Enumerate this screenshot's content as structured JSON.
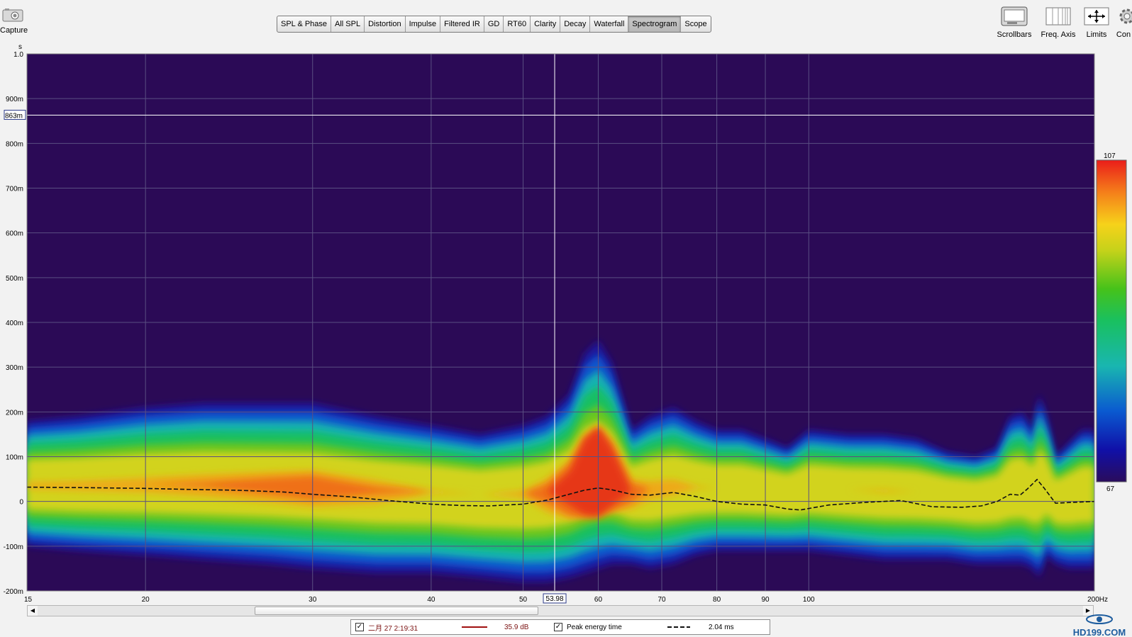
{
  "toolbar": {
    "capture_label": "Capture",
    "scrollbars_label": "Scrollbars",
    "freq_axis_label": "Freq. Axis",
    "limits_label": "Limits",
    "controls_label_partial": "Con"
  },
  "tabs": [
    "SPL & Phase",
    "All SPL",
    "Distortion",
    "Impulse",
    "Filtered IR",
    "GD",
    "RT60",
    "Clarity",
    "Decay",
    "Waterfall",
    "Spectrogram",
    "Scope"
  ],
  "active_tab": "Spectrogram",
  "chart_data": {
    "type": "heatmap",
    "title": "",
    "xlabel": "Hz",
    "ylabel": "s",
    "x_scale": "log",
    "xlim": [
      15,
      200
    ],
    "ylim": [
      -0.2,
      1.0
    ],
    "x_ticks": [
      15,
      20,
      30,
      40,
      50,
      60,
      70,
      80,
      90,
      100,
      200
    ],
    "x_tick_labels": [
      "15",
      "20",
      "30",
      "40",
      "50",
      "60",
      "70",
      "80",
      "90",
      "100",
      "200Hz"
    ],
    "y_ticks": [
      1.0,
      0.9,
      0.8,
      0.7,
      0.6,
      0.5,
      0.4,
      0.3,
      0.2,
      0.1,
      0.0,
      -0.1,
      -0.2
    ],
    "y_tick_labels": [
      "1.0",
      "900m",
      "800m",
      "700m",
      "600m",
      "500m",
      "400m",
      "300m",
      "200m",
      "100m",
      "0",
      "-100m",
      "-200m"
    ],
    "grid": true,
    "cursor": {
      "x": 53.98,
      "x_label": "53.98",
      "y": 0.863,
      "y_label": "863m"
    },
    "color_scale": {
      "max": 107,
      "min": 67,
      "max_label": "107",
      "min_label": "67",
      "colors": [
        "#2a0c5c",
        "#1010a8",
        "#0a5ad0",
        "#19b6b0",
        "#19c060",
        "#46c21a",
        "#c6d21a",
        "#f6d21a",
        "#f57f1a",
        "#ea1d1a"
      ]
    },
    "series": [
      {
        "name": "Peak energy time",
        "style": "dashed",
        "x": [
          15,
          17,
          20,
          22,
          25,
          28,
          30,
          33,
          36,
          40,
          43,
          46,
          50,
          53,
          55,
          58,
          60,
          62,
          65,
          68,
          72,
          76,
          80,
          85,
          90,
          95,
          98,
          105,
          115,
          125,
          135,
          145,
          152,
          158,
          163,
          167,
          170,
          174,
          177,
          182,
          190,
          200
        ],
        "y": [
          0.032,
          0.031,
          0.029,
          0.027,
          0.025,
          0.021,
          0.016,
          0.01,
          0.002,
          -0.006,
          -0.009,
          -0.01,
          -0.006,
          0.003,
          0.012,
          0.025,
          0.03,
          0.026,
          0.016,
          0.014,
          0.02,
          0.011,
          0.0,
          -0.006,
          -0.008,
          -0.017,
          -0.019,
          -0.008,
          -0.002,
          0.002,
          -0.012,
          -0.013,
          -0.01,
          0.0,
          0.016,
          0.014,
          0.028,
          0.049,
          0.03,
          -0.004,
          -0.002,
          0.0
        ]
      }
    ],
    "energy_band": {
      "x": [
        15,
        17,
        20,
        23,
        27,
        30,
        35,
        40,
        45,
        50,
        53,
        56,
        58,
        60,
        62,
        65,
        68,
        72,
        76,
        80,
        85,
        90,
        95,
        100,
        110,
        120,
        130,
        140,
        150,
        158,
        163,
        168,
        172,
        175,
        178,
        182,
        188,
        194,
        200
      ],
      "top": [
        0.18,
        0.19,
        0.21,
        0.22,
        0.22,
        0.22,
        0.19,
        0.17,
        0.15,
        0.17,
        0.19,
        0.24,
        0.33,
        0.36,
        0.31,
        0.16,
        0.19,
        0.21,
        0.18,
        0.16,
        0.16,
        0.14,
        0.12,
        0.16,
        0.15,
        0.15,
        0.14,
        0.11,
        0.1,
        0.12,
        0.19,
        0.2,
        0.16,
        0.24,
        0.19,
        0.1,
        0.13,
        0.16,
        0.16
      ],
      "bottom": [
        -0.1,
        -0.11,
        -0.12,
        -0.13,
        -0.14,
        -0.15,
        -0.16,
        -0.16,
        -0.17,
        -0.18,
        -0.18,
        -0.17,
        -0.16,
        -0.15,
        -0.14,
        -0.14,
        -0.15,
        -0.14,
        -0.12,
        -0.11,
        -0.11,
        -0.11,
        -0.11,
        -0.11,
        -0.12,
        -0.13,
        -0.13,
        -0.13,
        -0.14,
        -0.14,
        -0.14,
        -0.14,
        -0.15,
        -0.17,
        -0.12,
        -0.14,
        -0.15,
        -0.15,
        -0.15
      ],
      "peak": [
        0.65,
        0.67,
        0.7,
        0.74,
        0.79,
        0.82,
        0.75,
        0.62,
        0.56,
        0.64,
        0.8,
        0.92,
        0.98,
        1.0,
        0.96,
        0.82,
        0.72,
        0.7,
        0.62,
        0.55,
        0.52,
        0.55,
        0.5,
        0.52,
        0.55,
        0.62,
        0.5,
        0.45,
        0.4,
        0.45,
        0.5,
        0.48,
        0.45,
        0.4,
        0.42,
        0.38,
        0.4,
        0.42,
        0.4
      ]
    }
  },
  "legend": {
    "measurement_name": "二月 27 2:19:31",
    "measurement_value": "35.9 dB",
    "peak_label": "Peak energy time",
    "peak_value": "2.04 ms"
  },
  "watermark": "HD199.COM",
  "colors": {
    "plot_bg": "#2b0a56",
    "grid": "#5a4f82",
    "cursor": "#ffffff",
    "measure_line": "#a01010"
  }
}
